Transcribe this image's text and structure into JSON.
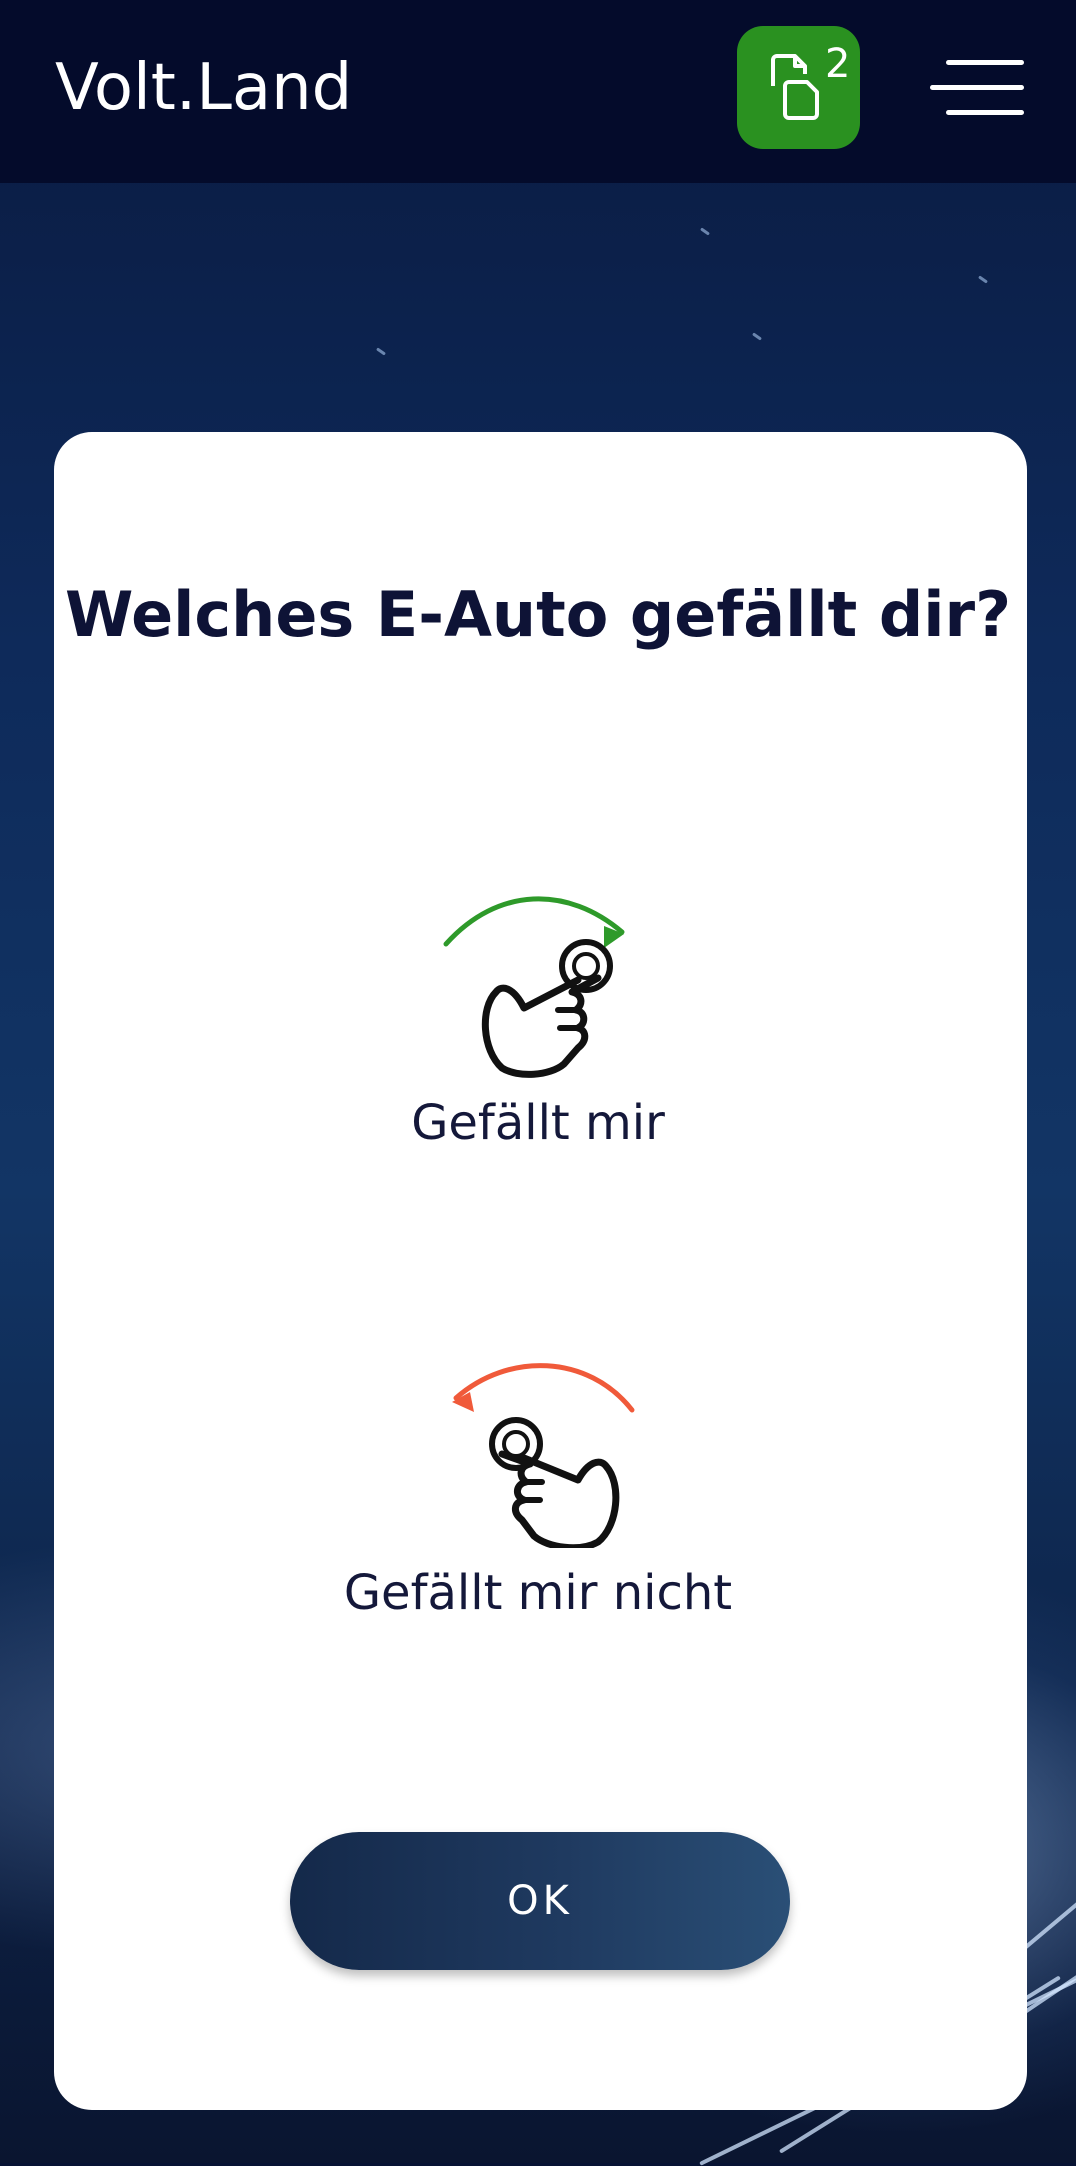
{
  "header": {
    "brand": "Volt.Land",
    "compare_count": "2",
    "compare_icon": "compare-documents-icon",
    "menu_icon": "hamburger-menu-icon"
  },
  "modal": {
    "title": "Welches E-Auto gefällt dir?",
    "like": {
      "label": "Gefällt mir",
      "icon": "swipe-right-hand-icon",
      "arrow_color": "#2e9a2a"
    },
    "dislike": {
      "label": "Gefällt mir nicht",
      "icon": "swipe-left-hand-icon",
      "arrow_color": "#f05a3a"
    },
    "ok_label": "OK"
  },
  "colors": {
    "header_bg": "#040b2b",
    "accent_green": "#2a9120",
    "button_dark": "#1f3a60",
    "title_text": "#0e1336"
  }
}
